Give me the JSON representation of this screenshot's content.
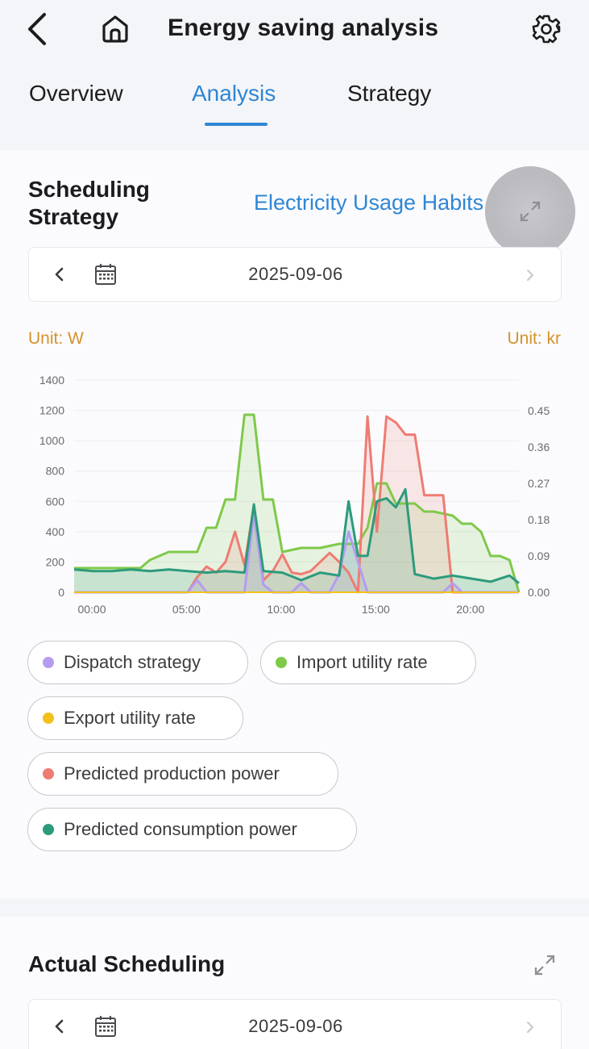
{
  "header": {
    "title": "Energy saving analysis"
  },
  "tabs": [
    {
      "label": "Overview",
      "active": false
    },
    {
      "label": "Analysis",
      "active": true
    },
    {
      "label": "Strategy",
      "active": false
    }
  ],
  "colors": {
    "accent": "#2f86d4",
    "unit_text": "#d4922c",
    "dispatch_strategy": "#b59cf0",
    "import_utility_rate": "#7ec94a",
    "export_utility_rate": "#f2c21c",
    "predicted_production_power": "#ee7c72",
    "predicted_consumption_power": "#2c9b7c"
  },
  "icons": {
    "back": "chevron-left-icon",
    "home": "home-icon",
    "settings": "gear-icon",
    "calendar": "calendar-icon",
    "expand": "expand-icon"
  },
  "scheduling_strategy": {
    "title_line1": "Scheduling",
    "title_line2": "Strategy",
    "link": "Electricity Usage Habits",
    "date": "2025-09-06",
    "unit_left": "Unit: W",
    "unit_right": "Unit: kr",
    "legend": [
      {
        "label": "Dispatch strategy",
        "color": "#b59cf0"
      },
      {
        "label": "Import utility rate",
        "color": "#7ec94a"
      },
      {
        "label": "Export utility rate",
        "color": "#f2c21c"
      },
      {
        "label": "Predicted production power",
        "color": "#ee7c72"
      },
      {
        "label": "Predicted consumption power",
        "color": "#2c9b7c"
      }
    ]
  },
  "actual_scheduling": {
    "title": "Actual Scheduling",
    "date": "2025-09-06"
  },
  "chart_data": {
    "type": "line",
    "x_ticks": [
      "00:00",
      "05:00",
      "10:00",
      "15:00",
      "20:00"
    ],
    "x_range_hours": [
      0,
      23.5
    ],
    "y_left": {
      "ticks": [
        "0",
        "200",
        "400",
        "600",
        "800",
        "1000",
        "1200",
        "1400"
      ],
      "range": [
        0,
        1400
      ]
    },
    "y_right": {
      "ticks": [
        "0.00",
        "0.09",
        "0.18",
        "0.27",
        "0.36",
        "0.45"
      ],
      "range": [
        0,
        0.45
      ]
    },
    "series": [
      {
        "name": "Dispatch strategy",
        "axis": "left",
        "color": "#b59cf0",
        "points": [
          [
            0,
            0
          ],
          [
            6,
            0
          ],
          [
            6.5,
            80
          ],
          [
            7,
            0
          ],
          [
            9,
            0
          ],
          [
            9.5,
            520
          ],
          [
            10,
            50
          ],
          [
            10.5,
            0
          ],
          [
            11.5,
            0
          ],
          [
            12,
            60
          ],
          [
            12.5,
            0
          ],
          [
            13.5,
            0
          ],
          [
            14,
            120
          ],
          [
            14.5,
            400
          ],
          [
            15,
            200
          ],
          [
            15.5,
            0
          ],
          [
            19.5,
            0
          ],
          [
            20,
            60
          ],
          [
            20.5,
            0
          ],
          [
            23.5,
            0
          ]
        ]
      },
      {
        "name": "Import utility rate",
        "axis": "right",
        "color": "#7ec94a",
        "points": [
          [
            0,
            0.06
          ],
          [
            3.5,
            0.06
          ],
          [
            4,
            0.08
          ],
          [
            5,
            0.1
          ],
          [
            6.5,
            0.1
          ],
          [
            7,
            0.16
          ],
          [
            7.5,
            0.16
          ],
          [
            8,
            0.23
          ],
          [
            8.5,
            0.23
          ],
          [
            9,
            0.44
          ],
          [
            9.5,
            0.44
          ],
          [
            10,
            0.23
          ],
          [
            10.5,
            0.23
          ],
          [
            11,
            0.1
          ],
          [
            12,
            0.11
          ],
          [
            13,
            0.11
          ],
          [
            14,
            0.12
          ],
          [
            15,
            0.12
          ],
          [
            15.5,
            0.16
          ],
          [
            16,
            0.27
          ],
          [
            16.5,
            0.27
          ],
          [
            17,
            0.22
          ],
          [
            17.5,
            0.22
          ],
          [
            18,
            0.22
          ],
          [
            18.5,
            0.2
          ],
          [
            19,
            0.2
          ],
          [
            20,
            0.19
          ],
          [
            20.5,
            0.17
          ],
          [
            21,
            0.17
          ],
          [
            21.5,
            0.15
          ],
          [
            22,
            0.09
          ],
          [
            22.5,
            0.09
          ],
          [
            23,
            0.08
          ],
          [
            23.5,
            0
          ]
        ]
      },
      {
        "name": "Export utility rate",
        "axis": "right",
        "color": "#f2c21c",
        "points": [
          [
            0,
            0
          ],
          [
            23.5,
            0
          ]
        ]
      },
      {
        "name": "Predicted production power",
        "axis": "left",
        "color": "#ee7c72",
        "points": [
          [
            0,
            0
          ],
          [
            6,
            0
          ],
          [
            6.5,
            100
          ],
          [
            7,
            170
          ],
          [
            7.5,
            130
          ],
          [
            8,
            200
          ],
          [
            8.5,
            400
          ],
          [
            9,
            180
          ],
          [
            9.5,
            570
          ],
          [
            10,
            80
          ],
          [
            10.5,
            140
          ],
          [
            11,
            250
          ],
          [
            11.5,
            130
          ],
          [
            12,
            120
          ],
          [
            12.5,
            140
          ],
          [
            13,
            200
          ],
          [
            13.5,
            260
          ],
          [
            14,
            200
          ],
          [
            14.5,
            130
          ],
          [
            15,
            0
          ],
          [
            15.5,
            1160
          ],
          [
            16,
            400
          ],
          [
            16.5,
            1160
          ],
          [
            17,
            1120
          ],
          [
            17.5,
            1040
          ],
          [
            18,
            1040
          ],
          [
            18.5,
            640
          ],
          [
            19,
            640
          ],
          [
            19.5,
            640
          ],
          [
            20,
            0
          ],
          [
            23.5,
            0
          ]
        ]
      },
      {
        "name": "Predicted consumption power",
        "axis": "left",
        "color": "#2c9b7c",
        "points": [
          [
            0,
            150
          ],
          [
            1,
            140
          ],
          [
            2,
            140
          ],
          [
            3,
            150
          ],
          [
            4,
            140
          ],
          [
            5,
            150
          ],
          [
            6,
            140
          ],
          [
            7,
            130
          ],
          [
            8,
            140
          ],
          [
            9,
            130
          ],
          [
            9.5,
            580
          ],
          [
            10,
            140
          ],
          [
            11,
            130
          ],
          [
            12,
            80
          ],
          [
            13,
            130
          ],
          [
            14,
            110
          ],
          [
            14.5,
            600
          ],
          [
            15,
            240
          ],
          [
            15.5,
            240
          ],
          [
            16,
            600
          ],
          [
            16.5,
            620
          ],
          [
            17,
            560
          ],
          [
            17.5,
            680
          ],
          [
            18,
            120
          ],
          [
            19,
            90
          ],
          [
            20,
            110
          ],
          [
            21,
            90
          ],
          [
            22,
            70
          ],
          [
            23,
            110
          ],
          [
            23.5,
            60
          ]
        ]
      }
    ]
  }
}
